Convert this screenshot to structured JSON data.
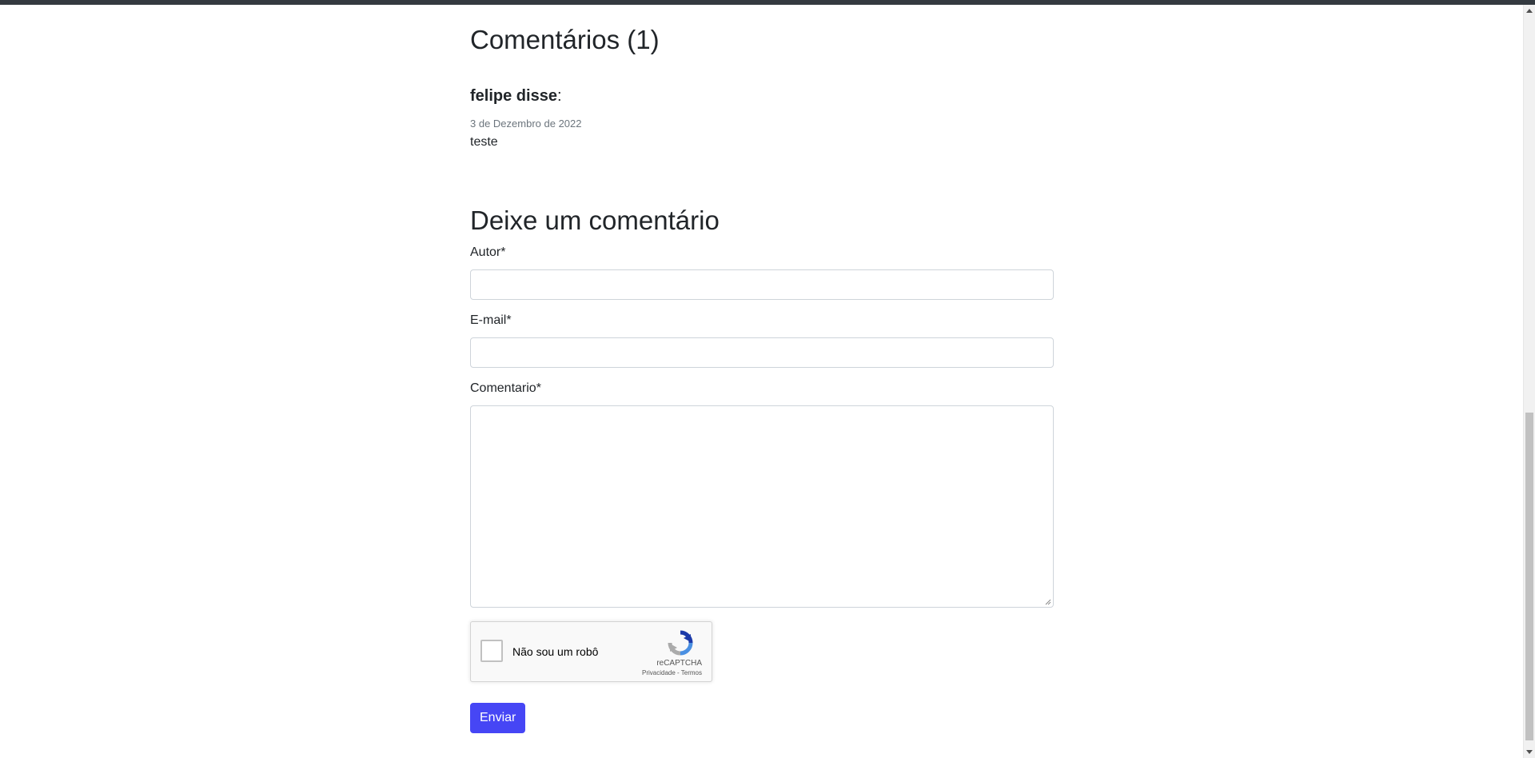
{
  "comments": {
    "title": "Comentários (1)",
    "items": [
      {
        "author": "felipe disse",
        "separator": ":",
        "date": "3 de Dezembro de 2022",
        "text": "teste"
      }
    ]
  },
  "form": {
    "title": "Deixe um comentário",
    "author_label": "Autor*",
    "email_label": "E-mail*",
    "comment_label": "Comentario*",
    "author_value": "",
    "email_value": "",
    "comment_value": "",
    "submit_label": "Enviar"
  },
  "recaptcha": {
    "label": "Não sou um robô",
    "brand": "reCAPTCHA",
    "links": "Privacidade - Termos"
  },
  "colors": {
    "primary_button": "#4646f5",
    "topbar": "#343a40",
    "date_text": "#6c757d"
  }
}
